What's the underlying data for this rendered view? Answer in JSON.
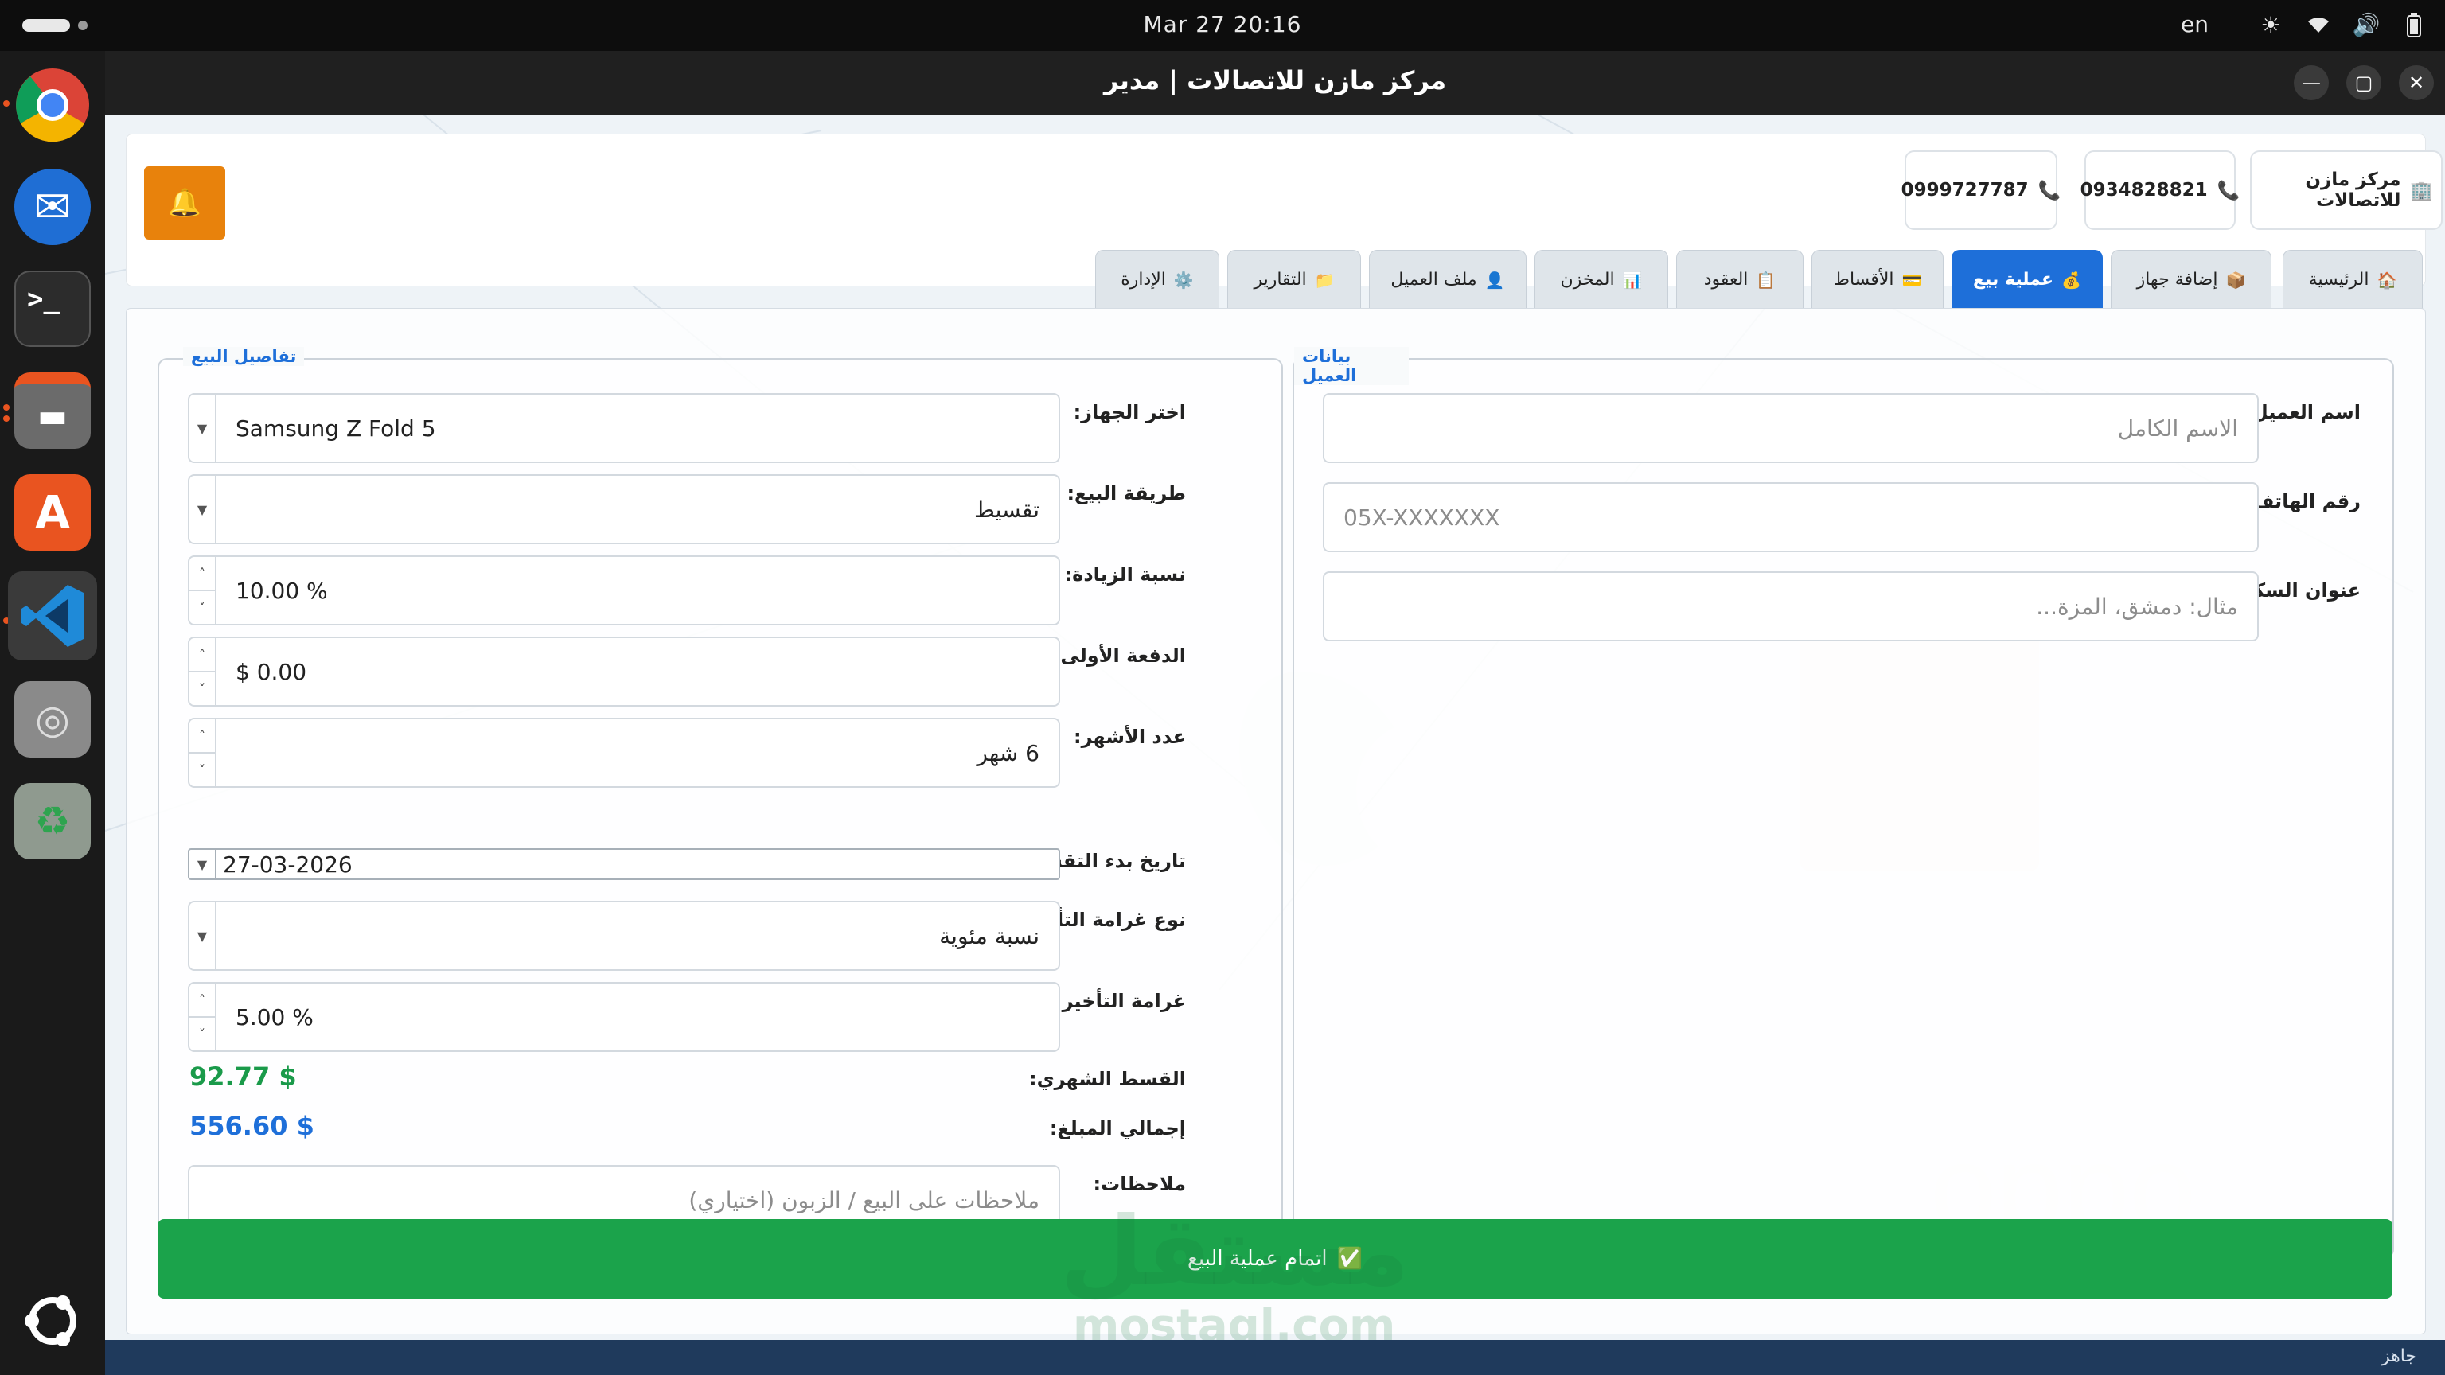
{
  "system": {
    "clock": "Mar 27  20:16",
    "lang": "en",
    "tray_icons": [
      "brightness-icon",
      "wifi-icon",
      "volume-icon",
      "battery-icon"
    ]
  },
  "dock": {
    "apps": [
      "chrome",
      "thunderbird",
      "terminal",
      "files",
      "app-center",
      "vscode",
      "disc",
      "trash",
      "ubuntu"
    ]
  },
  "window": {
    "title": "مركز مازن للاتصالات  |  مدير",
    "buttons": [
      "minimize",
      "maximize",
      "close"
    ]
  },
  "header": {
    "bell_icon": "🔔",
    "company": "مركز مازن للاتصالات",
    "company_icon": "🏢",
    "phone1": "0934828821",
    "phone2": "0999727787",
    "phone_icon": "📞"
  },
  "tabs": [
    {
      "label": "الرئيسية",
      "icon": "🏠"
    },
    {
      "label": "إضافة جهاز",
      "icon": "📦"
    },
    {
      "label": "عملية بيع",
      "icon": "💰"
    },
    {
      "label": "الأقساط",
      "icon": "💳"
    },
    {
      "label": "العقود",
      "icon": "📋"
    },
    {
      "label": "المخزن",
      "icon": "📊"
    },
    {
      "label": "ملف العميل",
      "icon": "👤"
    },
    {
      "label": "التقارير",
      "icon": "📁"
    },
    {
      "label": "الإدارة",
      "icon": "⚙️"
    }
  ],
  "active_tab": 2,
  "customer": {
    "title": "بيانات العميل",
    "name_label": "اسم العميل:",
    "name_placeholder": "الاسم الكامل",
    "phone_label": "رقم الهاتف:",
    "phone_placeholder": "05X-XXXXXXX",
    "address_label": "عنوان السكن:",
    "address_placeholder": "مثال: دمشق، المزة..."
  },
  "sale": {
    "title": "تفاصيل البيع",
    "device_label": "اختر الجهاز:",
    "device_value": "Samsung Z Fold 5",
    "method_label": "طريقة البيع:",
    "method_value": "تقسيط",
    "increase_label": "نسبة الزيادة:",
    "increase_value": "10.00 %",
    "down_label": "الدفعة الأولى:",
    "down_value": "$ 0.00",
    "months_label": "عدد الأشهر:",
    "months_value": "6 شهر",
    "start_label": "تاريخ بدء التقسيط:",
    "start_value": "27-03-2026",
    "late_type_label": "نوع غرامة التأخير:",
    "late_type_value": "نسبة مئوية",
    "late_pct_label": "غرامة التأخير (%):",
    "late_pct_value": "5.00 %",
    "monthly_label": "القسط الشهري:",
    "monthly_value": "92.77 $",
    "total_label": "إجمالي المبلغ:",
    "total_value": "556.60 $",
    "notes_label": "ملاحظات:",
    "notes_placeholder": "ملاحظات على البيع / الزبون (اختياري)"
  },
  "submit": {
    "label": "اتمام عملية البيع",
    "icon": "✅"
  },
  "status": "جاهز",
  "watermark": {
    "text": "مستقل",
    "url": "mostaql.com"
  },
  "colors": {
    "accent": "#1e6fd9",
    "submit": "#1ba34b",
    "monthly": "#1a9a4a",
    "total": "#1e6fd9",
    "bell": "#e8820c",
    "statusbar": "#1f3a5c"
  }
}
